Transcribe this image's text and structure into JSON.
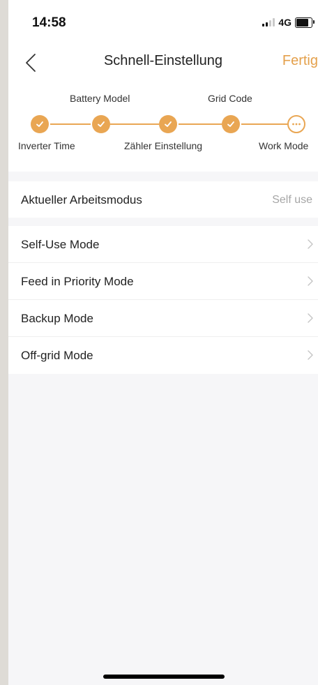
{
  "status_bar": {
    "time": "14:58",
    "network": "4G"
  },
  "nav": {
    "title": "Schnell-Einstellung",
    "done_label": "Fertig"
  },
  "stepper": {
    "top_labels": [
      "Battery Model",
      "Grid Code"
    ],
    "bottom_labels": [
      "Inverter Time",
      "Zähler Einstellung",
      "Work Mode"
    ],
    "steps": [
      "Inverter Time",
      "Battery Model",
      "Zähler Einstellung",
      "Grid Code",
      "Work Mode"
    ],
    "completed_count": 4,
    "accent_color": "#e9a653"
  },
  "current_mode": {
    "label": "Aktueller Arbeitsmodus",
    "value": "Self use"
  },
  "modes": [
    {
      "label": "Self-Use Mode"
    },
    {
      "label": "Feed in Priority Mode"
    },
    {
      "label": "Backup Mode"
    },
    {
      "label": "Off-grid Mode"
    }
  ],
  "icons": {
    "back": "chevron-left-icon",
    "step_done": "check-icon",
    "step_pending": "more-dots-icon",
    "list_arrow": "chevron-right-icon"
  },
  "colors": {
    "accent": "#e4a04b",
    "text": "#222222",
    "secondary_text": "#a6a6a6",
    "background": "#f6f6f8"
  }
}
